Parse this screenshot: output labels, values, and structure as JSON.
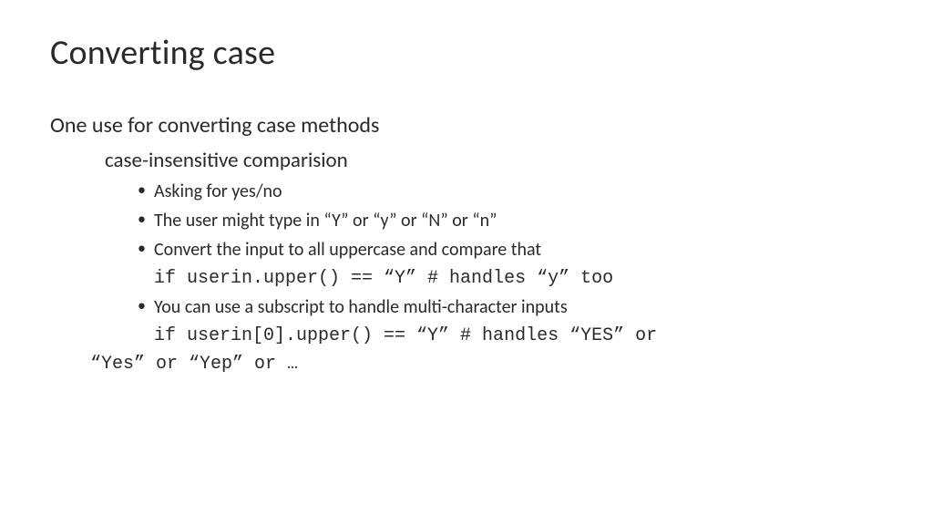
{
  "title": "Converting case",
  "intro": "One use for converting case methods",
  "subhead": "case-insensitive comparision",
  "bullets": {
    "b1": "Asking for yes/no",
    "b2": "The user might type in “Y” or “y” or “N” or “n”",
    "b3": "Convert the input to all uppercase and compare that",
    "b4": "You can use a subscript to handle multi-character inputs"
  },
  "code": {
    "c1": "if userin.upper() == “Y”  # handles “y” too",
    "c2a": "if userin[0].upper() == “Y”  # handles “YES” or",
    "c2b": "“Yes” or “Yep” or …"
  }
}
